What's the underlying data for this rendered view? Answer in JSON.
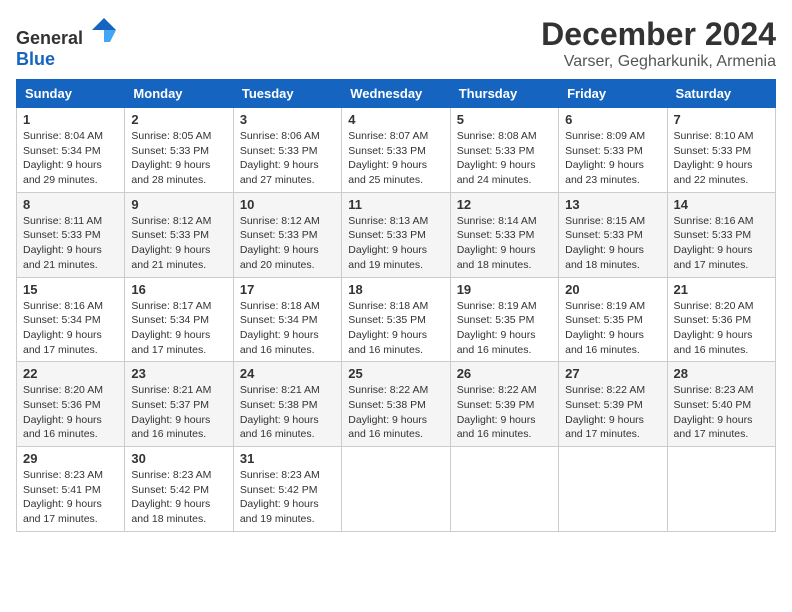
{
  "logo": {
    "general": "General",
    "blue": "Blue"
  },
  "header": {
    "month_year": "December 2024",
    "location": "Varser, Gegharkunik, Armenia"
  },
  "weekdays": [
    "Sunday",
    "Monday",
    "Tuesday",
    "Wednesday",
    "Thursday",
    "Friday",
    "Saturday"
  ],
  "weeks": [
    [
      {
        "day": "1",
        "sunrise": "8:04 AM",
        "sunset": "5:34 PM",
        "daylight": "9 hours and 29 minutes."
      },
      {
        "day": "2",
        "sunrise": "8:05 AM",
        "sunset": "5:33 PM",
        "daylight": "9 hours and 28 minutes."
      },
      {
        "day": "3",
        "sunrise": "8:06 AM",
        "sunset": "5:33 PM",
        "daylight": "9 hours and 27 minutes."
      },
      {
        "day": "4",
        "sunrise": "8:07 AM",
        "sunset": "5:33 PM",
        "daylight": "9 hours and 25 minutes."
      },
      {
        "day": "5",
        "sunrise": "8:08 AM",
        "sunset": "5:33 PM",
        "daylight": "9 hours and 24 minutes."
      },
      {
        "day": "6",
        "sunrise": "8:09 AM",
        "sunset": "5:33 PM",
        "daylight": "9 hours and 23 minutes."
      },
      {
        "day": "7",
        "sunrise": "8:10 AM",
        "sunset": "5:33 PM",
        "daylight": "9 hours and 22 minutes."
      }
    ],
    [
      {
        "day": "8",
        "sunrise": "8:11 AM",
        "sunset": "5:33 PM",
        "daylight": "9 hours and 21 minutes."
      },
      {
        "day": "9",
        "sunrise": "8:12 AM",
        "sunset": "5:33 PM",
        "daylight": "9 hours and 21 minutes."
      },
      {
        "day": "10",
        "sunrise": "8:12 AM",
        "sunset": "5:33 PM",
        "daylight": "9 hours and 20 minutes."
      },
      {
        "day": "11",
        "sunrise": "8:13 AM",
        "sunset": "5:33 PM",
        "daylight": "9 hours and 19 minutes."
      },
      {
        "day": "12",
        "sunrise": "8:14 AM",
        "sunset": "5:33 PM",
        "daylight": "9 hours and 18 minutes."
      },
      {
        "day": "13",
        "sunrise": "8:15 AM",
        "sunset": "5:33 PM",
        "daylight": "9 hours and 18 minutes."
      },
      {
        "day": "14",
        "sunrise": "8:16 AM",
        "sunset": "5:33 PM",
        "daylight": "9 hours and 17 minutes."
      }
    ],
    [
      {
        "day": "15",
        "sunrise": "8:16 AM",
        "sunset": "5:34 PM",
        "daylight": "9 hours and 17 minutes."
      },
      {
        "day": "16",
        "sunrise": "8:17 AM",
        "sunset": "5:34 PM",
        "daylight": "9 hours and 17 minutes."
      },
      {
        "day": "17",
        "sunrise": "8:18 AM",
        "sunset": "5:34 PM",
        "daylight": "9 hours and 16 minutes."
      },
      {
        "day": "18",
        "sunrise": "8:18 AM",
        "sunset": "5:35 PM",
        "daylight": "9 hours and 16 minutes."
      },
      {
        "day": "19",
        "sunrise": "8:19 AM",
        "sunset": "5:35 PM",
        "daylight": "9 hours and 16 minutes."
      },
      {
        "day": "20",
        "sunrise": "8:19 AM",
        "sunset": "5:35 PM",
        "daylight": "9 hours and 16 minutes."
      },
      {
        "day": "21",
        "sunrise": "8:20 AM",
        "sunset": "5:36 PM",
        "daylight": "9 hours and 16 minutes."
      }
    ],
    [
      {
        "day": "22",
        "sunrise": "8:20 AM",
        "sunset": "5:36 PM",
        "daylight": "9 hours and 16 minutes."
      },
      {
        "day": "23",
        "sunrise": "8:21 AM",
        "sunset": "5:37 PM",
        "daylight": "9 hours and 16 minutes."
      },
      {
        "day": "24",
        "sunrise": "8:21 AM",
        "sunset": "5:38 PM",
        "daylight": "9 hours and 16 minutes."
      },
      {
        "day": "25",
        "sunrise": "8:22 AM",
        "sunset": "5:38 PM",
        "daylight": "9 hours and 16 minutes."
      },
      {
        "day": "26",
        "sunrise": "8:22 AM",
        "sunset": "5:39 PM",
        "daylight": "9 hours and 16 minutes."
      },
      {
        "day": "27",
        "sunrise": "8:22 AM",
        "sunset": "5:39 PM",
        "daylight": "9 hours and 17 minutes."
      },
      {
        "day": "28",
        "sunrise": "8:23 AM",
        "sunset": "5:40 PM",
        "daylight": "9 hours and 17 minutes."
      }
    ],
    [
      {
        "day": "29",
        "sunrise": "8:23 AM",
        "sunset": "5:41 PM",
        "daylight": "9 hours and 17 minutes."
      },
      {
        "day": "30",
        "sunrise": "8:23 AM",
        "sunset": "5:42 PM",
        "daylight": "9 hours and 18 minutes."
      },
      {
        "day": "31",
        "sunrise": "8:23 AM",
        "sunset": "5:42 PM",
        "daylight": "9 hours and 19 minutes."
      },
      null,
      null,
      null,
      null
    ]
  ],
  "labels": {
    "sunrise_prefix": "Sunrise: ",
    "sunset_prefix": "Sunset: ",
    "daylight_prefix": "Daylight: "
  }
}
